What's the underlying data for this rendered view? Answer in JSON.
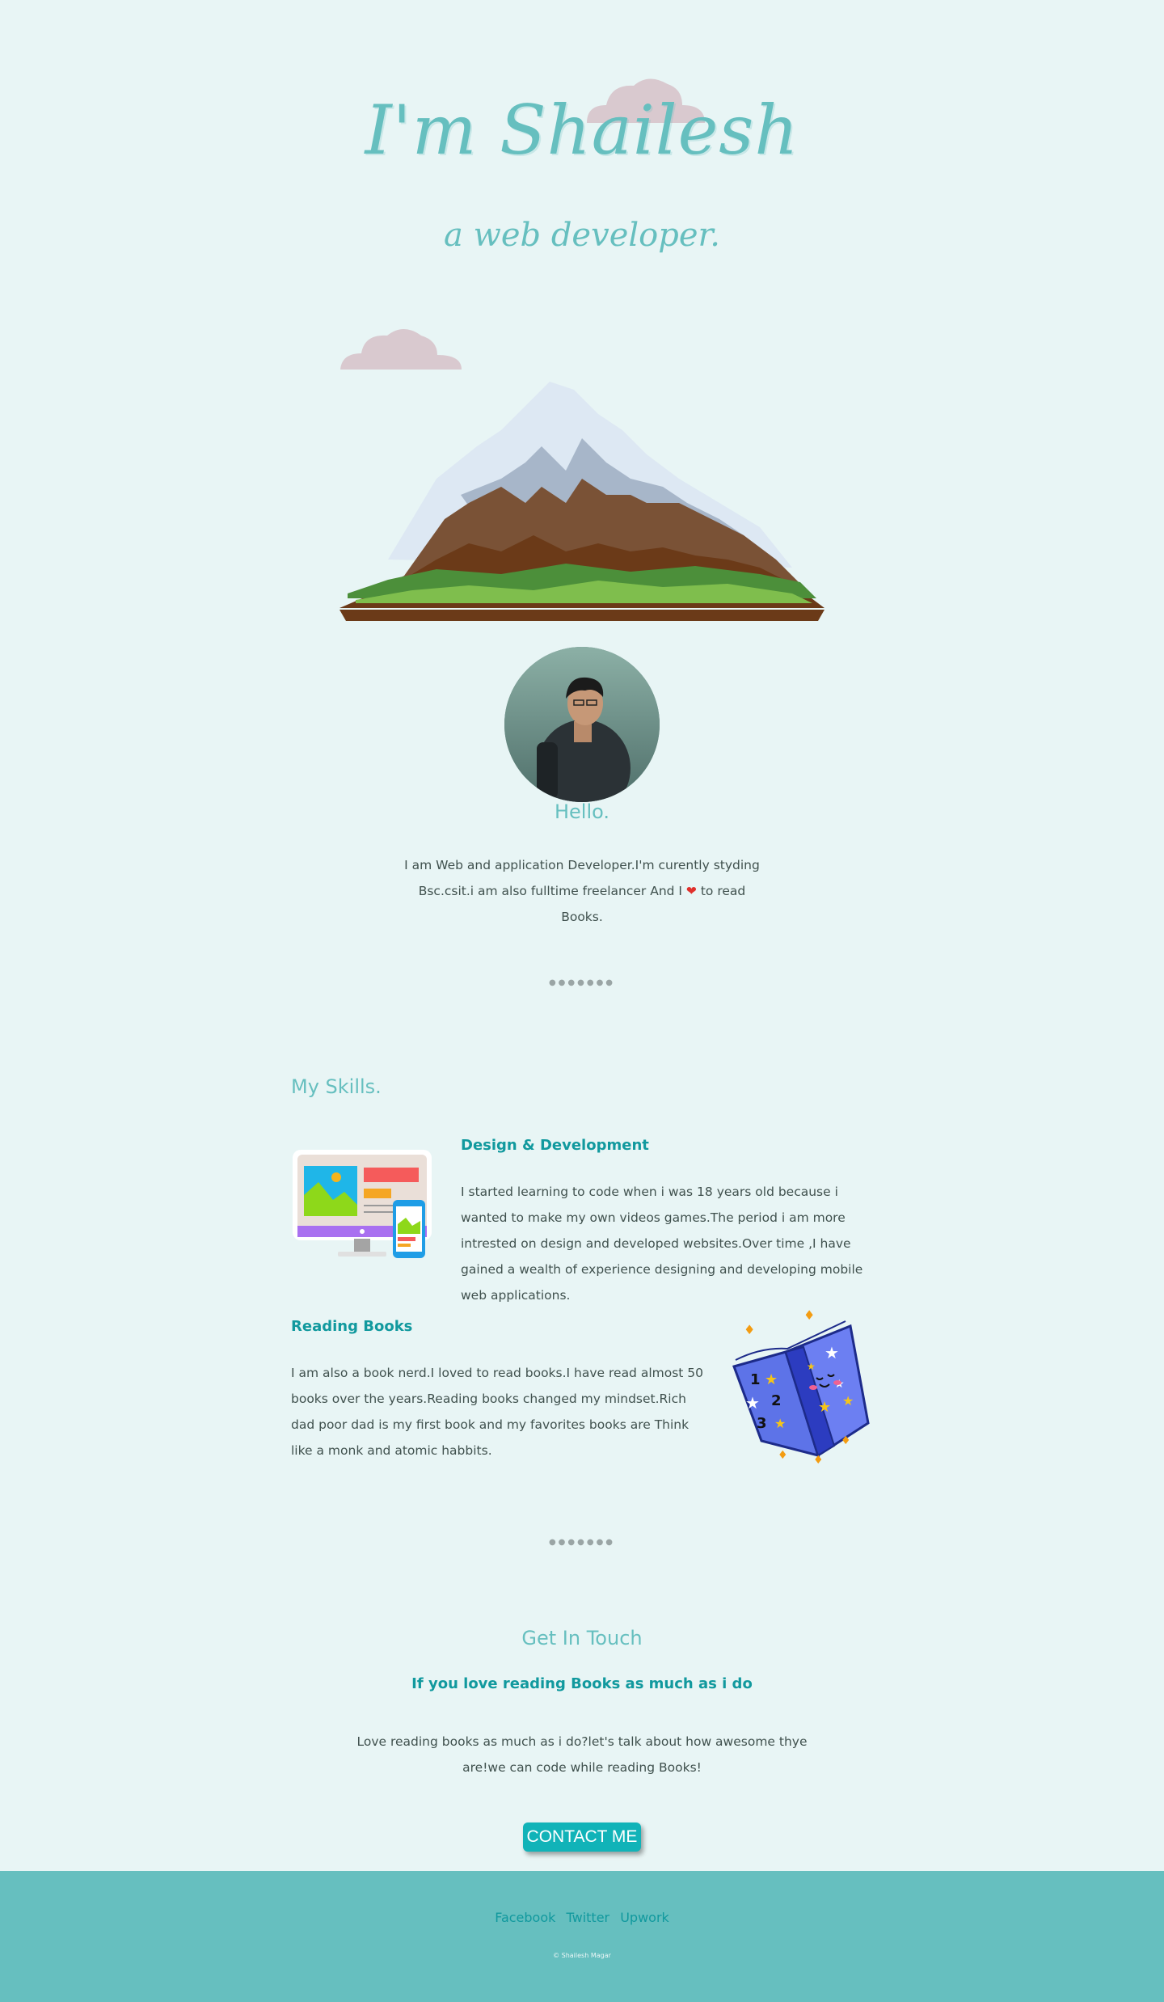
{
  "hero": {
    "title": "I'm Shailesh",
    "subtitle": "a web developer."
  },
  "profile": {
    "greeting": "Hello.",
    "intro_line_1": "I am Web and application Developer.I'm curently styding",
    "intro_line_2_before": "Bsc.csit.i am also fulltime freelancer And I",
    "intro_heart": "❤",
    "intro_line_2_after": "to read Books."
  },
  "divider": "●●●●●●●",
  "skills": {
    "title": "My Skills.",
    "items": [
      {
        "title": "Design & Development",
        "text": "I started learning to code when i was 18 years old because i wanted to make my own videos games.The period i am more intrested on design and developed websites.Over time ,I have gained a wealth of experience designing and developing mobile web applications.",
        "icon": "computer-monitor-icon"
      },
      {
        "title": "Reading Books",
        "text": "I am also a book nerd.I loved to read books.I have read almost 50 books over the years.Reading books changed my mindset.Rich dad poor dad is my first book and my favorites books are Think like a monk and atomic habbits.",
        "icon": "open-book-icon"
      }
    ]
  },
  "contact": {
    "title": "Get In Touch",
    "subtitle": "If you love reading Books as much as i do",
    "text": "Love reading books as much as i do?let's talk about how awesome thye are!we can code while reading Books!",
    "button_label": "CONTACT ME"
  },
  "footer": {
    "links": [
      "Facebook",
      "Twitter",
      "Upwork"
    ],
    "copyright": "© Shailesh Magar"
  },
  "colors": {
    "background": "#e8f5f5",
    "accent": "#66bfbf",
    "heading": "#11999e",
    "text": "#40514e",
    "cloud": "#d9c9cf"
  }
}
